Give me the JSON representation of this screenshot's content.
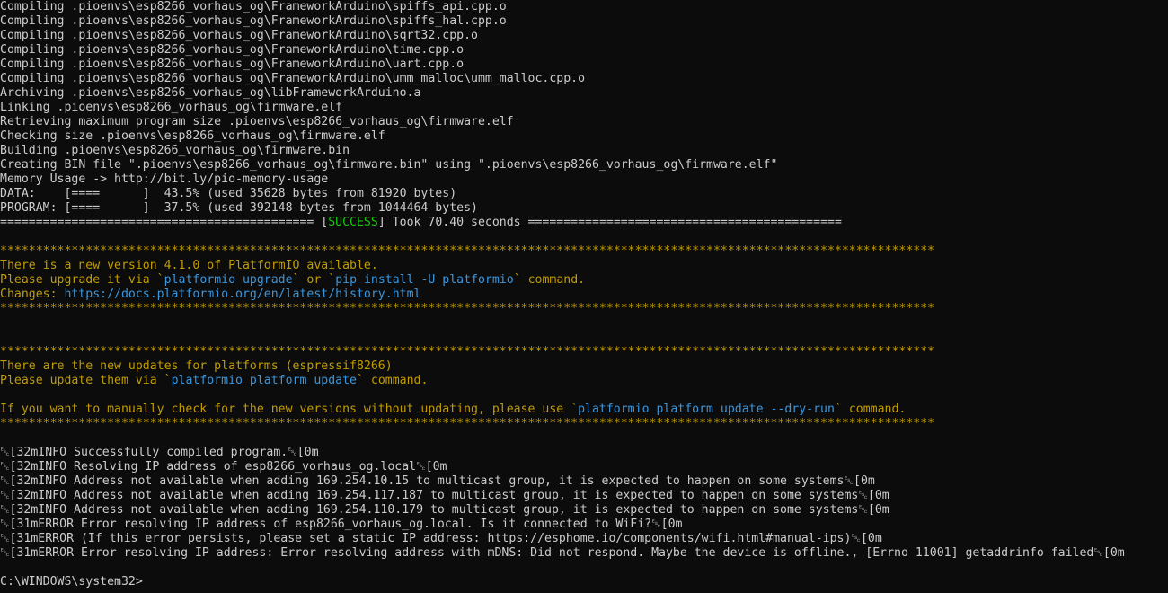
{
  "colors": {
    "background": "#0c0c0c",
    "gray": "#cccccc",
    "yellow": "#c19c00",
    "cyan": "#3a96dd",
    "green": "#16c60c"
  },
  "terminal": {
    "lines": [
      [
        {
          "t": "Compiling .pioenvs\\esp8266_vorhaus_og\\FrameworkArduino\\spiffs_api.cpp.o",
          "c": "gray"
        }
      ],
      [
        {
          "t": "Compiling .pioenvs\\esp8266_vorhaus_og\\FrameworkArduino\\spiffs_hal.cpp.o",
          "c": "gray"
        }
      ],
      [
        {
          "t": "Compiling .pioenvs\\esp8266_vorhaus_og\\FrameworkArduino\\sqrt32.cpp.o",
          "c": "gray"
        }
      ],
      [
        {
          "t": "Compiling .pioenvs\\esp8266_vorhaus_og\\FrameworkArduino\\time.cpp.o",
          "c": "gray"
        }
      ],
      [
        {
          "t": "Compiling .pioenvs\\esp8266_vorhaus_og\\FrameworkArduino\\uart.cpp.o",
          "c": "gray"
        }
      ],
      [
        {
          "t": "Compiling .pioenvs\\esp8266_vorhaus_og\\FrameworkArduino\\umm_malloc\\umm_malloc.cpp.o",
          "c": "gray"
        }
      ],
      [
        {
          "t": "Archiving .pioenvs\\esp8266_vorhaus_og\\libFrameworkArduino.a",
          "c": "gray"
        }
      ],
      [
        {
          "t": "Linking .pioenvs\\esp8266_vorhaus_og\\firmware.elf",
          "c": "gray"
        }
      ],
      [
        {
          "t": "Retrieving maximum program size .pioenvs\\esp8266_vorhaus_og\\firmware.elf",
          "c": "gray"
        }
      ],
      [
        {
          "t": "Checking size .pioenvs\\esp8266_vorhaus_og\\firmware.elf",
          "c": "gray"
        }
      ],
      [
        {
          "t": "Building .pioenvs\\esp8266_vorhaus_og\\firmware.bin",
          "c": "gray"
        }
      ],
      [
        {
          "t": "Creating BIN file \".pioenvs\\esp8266_vorhaus_og\\firmware.bin\" using \".pioenvs\\esp8266_vorhaus_og\\firmware.elf\"",
          "c": "gray"
        }
      ],
      [
        {
          "t": "Memory Usage -> http://bit.ly/pio-memory-usage",
          "c": "gray"
        }
      ],
      [
        {
          "t": "DATA:    [====      ]  43.5% (used 35628 bytes from 81920 bytes)",
          "c": "gray"
        }
      ],
      [
        {
          "t": "PROGRAM: [====      ]  37.5% (used 392148 bytes from 1044464 bytes)",
          "c": "gray"
        }
      ],
      [
        {
          "t": "============================================ [",
          "c": "gray"
        },
        {
          "t": "SUCCESS",
          "c": "green"
        },
        {
          "t": "] Took 70.40 seconds ============================================",
          "c": "gray"
        }
      ],
      [
        {
          "t": "",
          "c": "gray"
        }
      ],
      [
        {
          "t": "***********************************************************************************************************************************",
          "c": "yellow"
        }
      ],
      [
        {
          "t": "There is a new version 4.1.0 of PlatformIO available.",
          "c": "yellow"
        }
      ],
      [
        {
          "t": "Please upgrade it via `",
          "c": "yellow"
        },
        {
          "t": "platformio upgrade",
          "c": "cyan"
        },
        {
          "t": "` or `",
          "c": "yellow"
        },
        {
          "t": "pip install -U platformio",
          "c": "cyan"
        },
        {
          "t": "` command.",
          "c": "yellow"
        }
      ],
      [
        {
          "t": "Changes: ",
          "c": "yellow"
        },
        {
          "t": "https://docs.platformio.org/en/latest/history.html",
          "c": "cyan"
        }
      ],
      [
        {
          "t": "***********************************************************************************************************************************",
          "c": "yellow"
        }
      ],
      [
        {
          "t": "",
          "c": "gray"
        }
      ],
      [
        {
          "t": "",
          "c": "gray"
        }
      ],
      [
        {
          "t": "***********************************************************************************************************************************",
          "c": "yellow"
        }
      ],
      [
        {
          "t": "There are the new updates for platforms (espressif8266)",
          "c": "yellow"
        }
      ],
      [
        {
          "t": "Please update them via `",
          "c": "yellow"
        },
        {
          "t": "platformio platform update",
          "c": "cyan"
        },
        {
          "t": "` command.",
          "c": "yellow"
        }
      ],
      [
        {
          "t": "",
          "c": "gray"
        }
      ],
      [
        {
          "t": "If you want to manually check for the new versions without updating, please use `",
          "c": "yellow"
        },
        {
          "t": "platformio platform update --dry-run",
          "c": "cyan"
        },
        {
          "t": "` command.",
          "c": "yellow"
        }
      ],
      [
        {
          "t": "***********************************************************************************************************************************",
          "c": "yellow"
        }
      ],
      [
        {
          "t": "",
          "c": "gray"
        }
      ],
      [
        {
          "t": "␛[32mINFO Successfully compiled program.␛[0m",
          "c": "gray"
        }
      ],
      [
        {
          "t": "␛[32mINFO Resolving IP address of esp8266_vorhaus_og.local␛[0m",
          "c": "gray"
        }
      ],
      [
        {
          "t": "␛[32mINFO Address not available when adding 169.254.10.15 to multicast group, it is expected to happen on some systems␛[0m",
          "c": "gray"
        }
      ],
      [
        {
          "t": "␛[32mINFO Address not available when adding 169.254.117.187 to multicast group, it is expected to happen on some systems␛[0m",
          "c": "gray"
        }
      ],
      [
        {
          "t": "␛[32mINFO Address not available when adding 169.254.110.179 to multicast group, it is expected to happen on some systems␛[0m",
          "c": "gray"
        }
      ],
      [
        {
          "t": "␛[31mERROR Error resolving IP address of esp8266_vorhaus_og.local. Is it connected to WiFi?␛[0m",
          "c": "gray"
        }
      ],
      [
        {
          "t": "␛[31mERROR (If this error persists, please set a static IP address: https://esphome.io/components/wifi.html#manual-ips)␛[0m",
          "c": "gray"
        }
      ],
      [
        {
          "t": "␛[31mERROR Error resolving IP address: Error resolving address with mDNS: Did not respond. Maybe the device is offline., [Errno 11001] getaddrinfo failed␛[0m",
          "c": "gray"
        }
      ],
      [
        {
          "t": "",
          "c": "gray"
        }
      ],
      [
        {
          "t": "C:\\WINDOWS\\system32>",
          "c": "gray"
        }
      ]
    ]
  }
}
